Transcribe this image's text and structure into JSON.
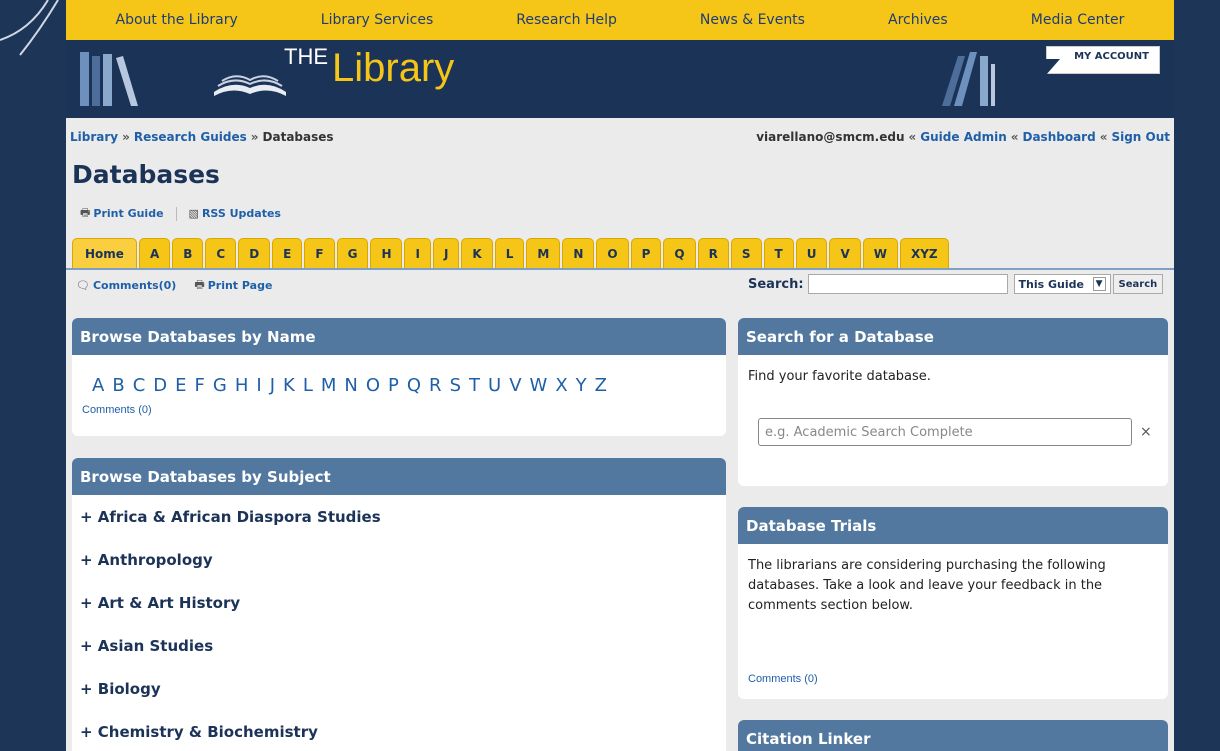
{
  "top_nav": [
    "About the Library",
    "Library Services",
    "Research Help",
    "News & Events",
    "Archives",
    "Media Center"
  ],
  "header": {
    "logo_the": "THE",
    "logo_library": "Library",
    "my_account": "MY ACCOUNT"
  },
  "breadcrumb": {
    "library": "Library",
    "research_guides": "Research Guides",
    "current": "Databases",
    "separator": "»"
  },
  "user_bar": {
    "email": "viarellano@smcm.edu",
    "guide_admin": "Guide Admin",
    "dashboard": "Dashboard",
    "sign_out": "Sign Out",
    "separator": "«"
  },
  "page_title": "Databases",
  "guide_tools": {
    "print_guide": "Print Guide",
    "rss_updates": "RSS Updates"
  },
  "tabs": [
    "Home",
    "A",
    "B",
    "C",
    "D",
    "E",
    "F",
    "G",
    "H",
    "I",
    "J",
    "K",
    "L",
    "M",
    "N",
    "O",
    "P",
    "Q",
    "R",
    "S",
    "T",
    "U",
    "V",
    "W",
    "XYZ"
  ],
  "page_tools": {
    "comments": "Comments(0)",
    "print_page": "Print Page"
  },
  "search": {
    "label": "Search:",
    "value": "",
    "scope": "This Guide",
    "button": "Search"
  },
  "browse_by_name": {
    "title": "Browse Databases by Name",
    "letters": [
      "A",
      "B",
      "C",
      "D",
      "E",
      "F",
      "G",
      "H",
      "I",
      "J",
      "K",
      "L",
      "M",
      "N",
      "O",
      "P",
      "Q",
      "R",
      "S",
      "T",
      "U",
      "V",
      "W",
      "X",
      "Y",
      "Z"
    ],
    "comments": "Comments (0)"
  },
  "browse_by_subject": {
    "title": "Browse Databases by Subject",
    "subjects": [
      "+ Africa & African Diaspora Studies",
      "+ Anthropology",
      "+ Art & Art History",
      "+ Asian Studies",
      "+ Biology",
      "+ Chemistry & Biochemistry"
    ]
  },
  "search_db": {
    "title": "Search for a Database",
    "text": "Find your favorite database.",
    "placeholder": "e.g. Academic Search Complete",
    "clear": "×"
  },
  "trials": {
    "title": "Database Trials",
    "text": "The librarians are considering purchasing the following databases. Take a look and leave your feedback in the comments section below.",
    "comments": "Comments (0)"
  },
  "citation_linker": {
    "title": "Citation Linker"
  },
  "colors": {
    "navy": "#1c3358",
    "gold": "#f5c518",
    "box_header": "#52789f",
    "link": "#1f5fa8"
  }
}
